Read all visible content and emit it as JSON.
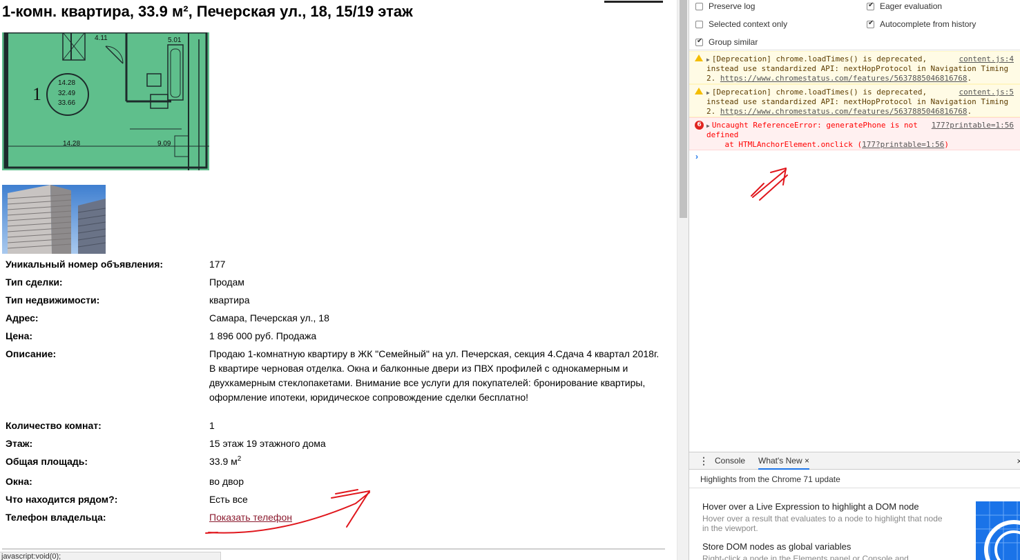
{
  "listing": {
    "title": "1-комн. квартира, 33.9 м², Печерская ул., 18, 15/19 этаж",
    "floorplan": {
      "room_number": "1",
      "area_total": "14.28",
      "area_living": "32.49",
      "area_full": "33.66",
      "kitchen": "4.11",
      "bathroom": "5.01",
      "bottom_left": "14.28",
      "bottom_right": "9.09"
    },
    "fields": [
      {
        "label": "Уникальный номер объявления:",
        "value": "177"
      },
      {
        "label": "Тип сделки:",
        "value": "Продам"
      },
      {
        "label": "Тип недвижимости:",
        "value": "квартира"
      },
      {
        "label": "Адрес:",
        "value": "Самара, Печерская ул., 18"
      },
      {
        "label": "Цена:",
        "value": "1 896 000 руб. Продажа"
      },
      {
        "label": "Описание:",
        "value": "Продаю 1-комнатную квартиру в ЖК \"Семейный\" на ул. Печерская, секция 4.Сдача 4 квартал 2018г. В квартире черновая отделка. Окна и балконные двери из ПВХ профилей с однокамерным и двухкамерным стеклопакетами. Внимание все услуги для покупателей: бронирование квартиры, оформление ипотеки, юридическое сопровождение сделки бесплатно!"
      },
      {
        "label": "Количество комнат:",
        "value": "1"
      },
      {
        "label": "Этаж:",
        "value": "15 этаж 19 этажного дома"
      },
      {
        "label": "Общая площадь:",
        "value": "33.9 м",
        "sup": "2"
      },
      {
        "label": "Окна:",
        "value": "во двор"
      },
      {
        "label": "Что находится рядом?:",
        "value": "Есть все"
      },
      {
        "label": "Телефон владельца:",
        "link": "Показать телефон"
      }
    ]
  },
  "status_bar": "javascript:void(0);",
  "devtools": {
    "settings": {
      "preserve_log": {
        "label": "Preserve log",
        "checked": false
      },
      "selected_context": {
        "label": "Selected context only",
        "checked": false
      },
      "group_similar": {
        "label": "Group similar",
        "checked": true
      },
      "eager_eval": {
        "label": "Eager evaluation",
        "checked": true
      },
      "autocomplete": {
        "label": "Autocomplete from history",
        "checked": true
      }
    },
    "messages": [
      {
        "level": "warning",
        "line1": "[Deprecation] chrome.loadTimes() is deprecated,",
        "line2": "instead use standardized API: nextHopProtocol in Navigation Timing",
        "line3_prefix": "2. ",
        "url": "https://www.chromestatus.com/features/5637885046816768",
        "line3_suffix": ".",
        "source": "content.js:4"
      },
      {
        "level": "warning",
        "line1": "[Deprecation] chrome.loadTimes() is deprecated,",
        "line2": "instead use standardized API: nextHopProtocol in Navigation Timing",
        "line3_prefix": "2. ",
        "url": "https://www.chromestatus.com/features/5637885046816768",
        "line3_suffix": ".",
        "source": "content.js:5"
      },
      {
        "level": "error",
        "count": "6",
        "line1": "Uncaught ReferenceError: generatePhone is not",
        "line2": "defined",
        "line3_prefix": "    at HTMLAnchorElement.onclick (",
        "url": "177?printable=1:56",
        "line3_suffix": ")",
        "source": "177?printable=1:56"
      }
    ],
    "prompt": "›",
    "drawer": {
      "tabs": [
        "Console",
        "What's New"
      ],
      "close_glyph": "×",
      "whats_new_header": "Highlights from the Chrome 71 update",
      "items": [
        {
          "title": "Hover over a Live Expression to highlight a DOM node",
          "desc": "Hover over a result that evaluates to a node to highlight that node in the viewport."
        },
        {
          "title": "Store DOM nodes as global variables",
          "desc": "Right-click a node in the Elements panel or Console and"
        }
      ]
    }
  },
  "colors": {
    "floorplan_green": "#5fbf8c",
    "link": "#8b1a2e",
    "annotation_red": "#e0161c",
    "chrome_blue": "#1a73e8"
  }
}
